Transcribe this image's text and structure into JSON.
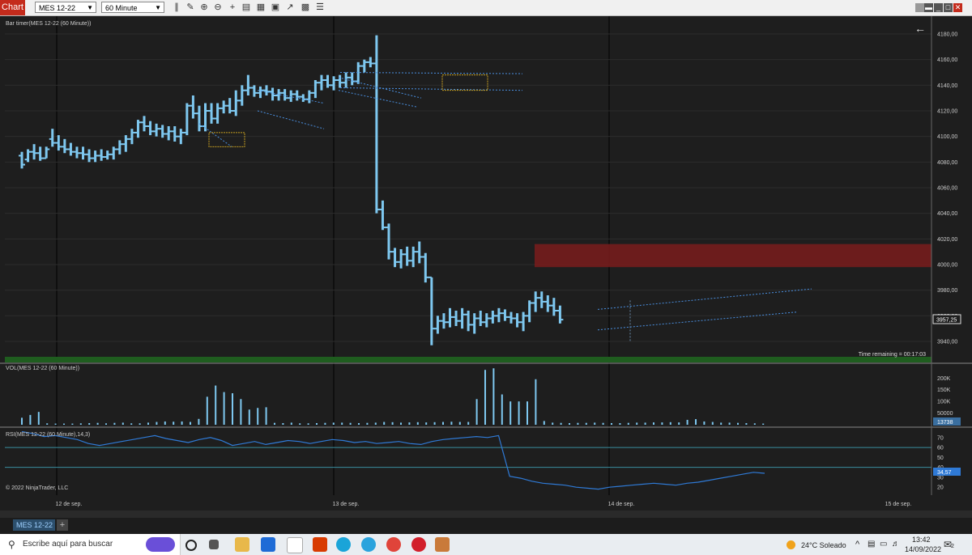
{
  "toolbar": {
    "title": "Chart",
    "instrument": "MES 12-22",
    "interval": "60 Minute"
  },
  "panel_labels": {
    "price": "Bar timer(MES 12-22 (60 Minute))",
    "volume": "VOL(MES 12-22 (60 Minute))",
    "rsi": "RSI(MES 12-22 (60 Minute),14,3)",
    "copyright": "© 2022 NinjaTrader, LLC",
    "time_remaining": "Time remaining = 00:17:03"
  },
  "tab": {
    "label": "MES 12-22"
  },
  "taskbar": {
    "search_placeholder": "Escribe aquí para buscar",
    "weather": "24°C  Soleado",
    "time": "13:42",
    "date": "14/09/2022",
    "notification_count": "2"
  },
  "colors": {
    "background": "#1e1e1e",
    "bar": "#7ec8f0",
    "zone": "#7a1c1c",
    "rsi_line": "#2f7ad6",
    "grid": "#2c2c2c"
  },
  "chart_data": [
    {
      "type": "ohlc",
      "title": "Bar timer(MES 12-22 (60 Minute))",
      "y_ticks": [
        "4180,00",
        "4160,00",
        "4140,00",
        "4120,00",
        "4100,00",
        "4080,00",
        "4060,00",
        "4040,00",
        "4020,00",
        "4000,00",
        "3980,00",
        "3960,00",
        "3940,00"
      ],
      "ylim": [
        3935,
        4185
      ],
      "last_price": "3957,25",
      "x_labels": [
        "12 de sep.",
        "13 de sep.",
        "14 de sep.",
        "15 de sep."
      ],
      "series": [
        {
          "name": "MES 12-22",
          "bars": [
            [
              4085,
              4088,
              4075,
              4078
            ],
            [
              4082,
              4090,
              4080,
              4088
            ],
            [
              4088,
              4094,
              4082,
              4087
            ],
            [
              4087,
              4092,
              4081,
              4083
            ],
            [
              4083,
              4092,
              4083,
              4090
            ],
            [
              4098,
              4106,
              4092,
              4095
            ],
            [
              4095,
              4101,
              4089,
              4092
            ],
            [
              4092,
              4098,
              4087,
              4090
            ],
            [
              4090,
              4095,
              4085,
              4088
            ],
            [
              4088,
              4092,
              4083,
              4087
            ],
            [
              4087,
              4092,
              4082,
              4086
            ],
            [
              4086,
              4090,
              4080,
              4083
            ],
            [
              4083,
              4089,
              4080,
              4085
            ],
            [
              4085,
              4090,
              4081,
              4084
            ],
            [
              4084,
              4089,
              4082,
              4086
            ],
            [
              4086,
              4092,
              4082,
              4090
            ],
            [
              4090,
              4097,
              4086,
              4094
            ],
            [
              4094,
              4101,
              4088,
              4098
            ],
            [
              4098,
              4106,
              4094,
              4103
            ],
            [
              4103,
              4113,
              4099,
              4111
            ],
            [
              4111,
              4116,
              4104,
              4108
            ],
            [
              4108,
              4112,
              4101,
              4104
            ],
            [
              4104,
              4110,
              4100,
              4106
            ],
            [
              4106,
              4109,
              4099,
              4102
            ],
            [
              4102,
              4108,
              4097,
              4104
            ],
            [
              4104,
              4108,
              4096,
              4100
            ],
            [
              4100,
              4106,
              4094,
              4103
            ],
            [
              4103,
              4126,
              4101,
              4124
            ],
            [
              4124,
              4132,
              4114,
              4118
            ],
            [
              4118,
              4124,
              4104,
              4108
            ],
            [
              4108,
              4126,
              4104,
              4120
            ],
            [
              4120,
              4126,
              4110,
              4114
            ],
            [
              4114,
              4126,
              4110,
              4122
            ],
            [
              4122,
              4128,
              4118,
              4124
            ],
            [
              4124,
              4130,
              4118,
              4120
            ],
            [
              4120,
              4136,
              4116,
              4128
            ],
            [
              4128,
              4140,
              4124,
              4136
            ],
            [
              4136,
              4148,
              4132,
              4138
            ],
            [
              4138,
              4140,
              4131,
              4134
            ],
            [
              4134,
              4139,
              4130,
              4136
            ],
            [
              4136,
              4140,
              4132,
              4135
            ],
            [
              4135,
              4138,
              4128,
              4132
            ],
            [
              4132,
              4137,
              4128,
              4134
            ],
            [
              4134,
              4137,
              4128,
              4130
            ],
            [
              4130,
              4136,
              4127,
              4133
            ],
            [
              4133,
              4136,
              4128,
              4131
            ],
            [
              4131,
              4133,
              4127,
              4129
            ],
            [
              4129,
              4136,
              4126,
              4134
            ],
            [
              4134,
              4144,
              4130,
              4142
            ],
            [
              4142,
              4148,
              4136,
              4144
            ],
            [
              4144,
              4148,
              4138,
              4140
            ],
            [
              4140,
              4147,
              4136,
              4144
            ],
            [
              4144,
              4148,
              4138,
              4142
            ],
            [
              4142,
              4150,
              4138,
              4146
            ],
            [
              4146,
              4150,
              4140,
              4143
            ],
            [
              4143,
              4158,
              4141,
              4155
            ],
            [
              4155,
              4160,
              4150,
              4158
            ],
            [
              4158,
              4162,
              4154,
              4157
            ],
            [
              4157,
              4179,
              4040,
              4043
            ],
            [
              4043,
              4050,
              4027,
              4029
            ],
            [
              4029,
              4032,
              4004,
              4010
            ],
            [
              4010,
              4013,
              3998,
              4002
            ],
            [
              4002,
              4012,
              3997,
              4008
            ],
            [
              4008,
              4014,
              3999,
              4003
            ],
            [
              4003,
              4014,
              3998,
              4010
            ],
            [
              4010,
              4018,
              4001,
              4006
            ],
            [
              4006,
              4009,
              3986,
              3990
            ],
            [
              3990,
              3990,
              3937,
              3950
            ],
            [
              3950,
              3960,
              3946,
              3956
            ],
            [
              3956,
              3962,
              3950,
              3955
            ],
            [
              3955,
              3966,
              3951,
              3959
            ],
            [
              3959,
              3964,
              3952,
              3956
            ],
            [
              3956,
              3966,
              3950,
              3961
            ],
            [
              3961,
              3964,
              3948,
              3953
            ],
            [
              3953,
              3962,
              3946,
              3958
            ],
            [
              3958,
              3964,
              3952,
              3955
            ],
            [
              3955,
              3962,
              3951,
              3958
            ],
            [
              3958,
              3964,
              3954,
              3960
            ],
            [
              3960,
              3966,
              3955,
              3962
            ],
            [
              3962,
              3965,
              3956,
              3959
            ],
            [
              3959,
              3963,
              3954,
              3958
            ],
            [
              3958,
              3962,
              3951,
              3955
            ],
            [
              3955,
              3963,
              3948,
              3960
            ],
            [
              3960,
              3972,
              3955,
              3970
            ],
            [
              3970,
              3979,
              3963,
              3974
            ],
            [
              3974,
              3979,
              3966,
              3971
            ],
            [
              3971,
              3976,
              3963,
              3968
            ],
            [
              3968,
              3974,
              3960,
              3964
            ],
            [
              3964,
              3968,
              3954,
              3957
            ]
          ]
        }
      ],
      "demand_zone": [
        3998,
        4016
      ]
    },
    {
      "type": "bar",
      "title": "VOL(MES 12-22 (60 Minute))",
      "y_ticks": [
        "200K",
        "150K",
        "100K",
        "50000"
      ],
      "ylim": [
        0,
        260000
      ],
      "last_value": "13738",
      "series": [
        {
          "name": "VOL",
          "values": [
            30000,
            42000,
            55000,
            6000,
            5000,
            5000,
            5000,
            6000,
            7000,
            8000,
            6000,
            8000,
            9000,
            6000,
            6000,
            9000,
            12000,
            14000,
            13000,
            14000,
            12000,
            25000,
            120000,
            168000,
            140000,
            135000,
            110000,
            65000,
            72000,
            75000,
            8000,
            7000,
            9000,
            6000,
            6000,
            7000,
            8000,
            9000,
            9000,
            8000,
            7000,
            8000,
            9000,
            12000,
            11000,
            9000,
            10000,
            11000,
            10000,
            11000,
            12000,
            13000,
            12000,
            12000,
            110000,
            235000,
            242000,
            130000,
            100000,
            100000,
            100000,
            195000,
            16000,
            9000,
            8000,
            7000,
            8000,
            8000,
            9000,
            8000,
            7000,
            7000,
            8000,
            9000,
            9000,
            10000,
            10000,
            11000,
            10000,
            21000,
            24000,
            14000,
            12000,
            9000,
            9000,
            8000,
            7000,
            6000,
            5000
          ]
        }
      ]
    },
    {
      "type": "line",
      "title": "RSI(MES 12-22 (60 Minute),14,3)",
      "y_ticks": [
        "70",
        "60",
        "50",
        "40",
        "30",
        "20"
      ],
      "ylim": [
        12,
        78
      ],
      "upper_line": 60,
      "lower_line": 40,
      "last_value": "34,57",
      "series": [
        {
          "name": "RSI",
          "values": [
            76,
            74,
            71,
            72,
            70,
            68,
            64,
            62,
            64,
            66,
            68,
            70,
            72,
            69,
            67,
            65,
            68,
            70,
            67,
            62,
            64,
            66,
            63,
            65,
            67,
            66,
            64,
            66,
            68,
            67,
            65,
            66,
            64,
            65,
            66,
            64,
            63,
            66,
            68,
            69,
            70,
            71,
            70,
            72,
            31,
            29,
            26,
            24,
            23,
            22,
            20,
            19,
            18,
            20,
            21,
            22,
            23,
            24,
            23,
            22,
            24,
            25,
            27,
            29,
            31,
            33,
            35,
            34
          ]
        }
      ]
    }
  ]
}
